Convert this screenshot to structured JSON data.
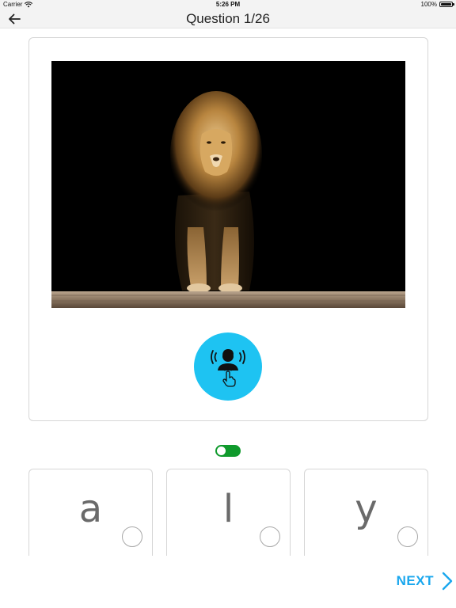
{
  "status_bar": {
    "carrier": "Carrier",
    "time": "5:26 PM",
    "battery_text": "100%",
    "battery_level": 1.0
  },
  "nav": {
    "title": "Question 1/26",
    "back_icon": "arrow-left-icon"
  },
  "question": {
    "image_subject": "lion-photo",
    "speak_icon": "speaker-tap-icon",
    "speak_color": "#1ec3f2"
  },
  "toggle": {
    "state": "on",
    "color": "#0f9a2c"
  },
  "options": [
    {
      "letter": "a"
    },
    {
      "letter": "l"
    },
    {
      "letter": "y"
    }
  ],
  "footer": {
    "next_label": "NEXT",
    "next_icon": "chevron-right-icon",
    "accent": "#1aa7ee"
  }
}
